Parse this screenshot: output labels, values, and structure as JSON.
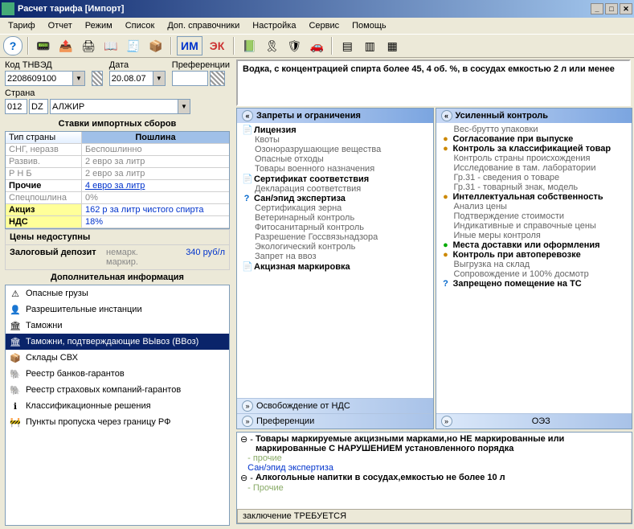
{
  "window": {
    "title": "Расчет тарифа [Импорт]"
  },
  "menu": [
    "Тариф",
    "Отчет",
    "Режим",
    "Список",
    "Доп. справочники",
    "Настройка",
    "Сервис",
    "Помощь"
  ],
  "fields": {
    "tnved_label": "Код ТНВЭД",
    "tnved": "2208609100",
    "date_label": "Дата",
    "date": "20.08.07",
    "pref_label": "Преференции",
    "pref": "",
    "country_label": "Страна",
    "country_code": "012",
    "country_iso": "DZ",
    "country_name": "АЛЖИР"
  },
  "description": "Водка, с концентрацией спирта более 45, 4 об. %, в сосудах емкостью 2 л или менее",
  "rates": {
    "header": "Ставки импортных сборов",
    "cols": [
      "Тип страны",
      "Пошлина"
    ],
    "rows": [
      {
        "c1": "СНГ, неразв",
        "c2": "Беспошлинно",
        "cls": "gray"
      },
      {
        "c1": "Развив.",
        "c2": "2 евро за литр",
        "cls": "gray"
      },
      {
        "c1": "Р Н Б",
        "c2": "2 евро за литр",
        "cls": "gray"
      },
      {
        "c1": "Прочие",
        "c2": "4 евро за литр",
        "cls": "blue-u",
        "bold": true
      }
    ],
    "extra": [
      {
        "c1": "Спецпошлина",
        "c2": "0%",
        "cls": "gray"
      },
      {
        "c1": "Акциз",
        "c2": "162 р за литр чистого спирта",
        "cls": "blue",
        "yl": true
      },
      {
        "c1": "НДС",
        "c2": "18%",
        "cls": "blue",
        "yl": true
      }
    ]
  },
  "prices": {
    "unavail": "Цены недоступны",
    "deposit_label": "Залоговый депозит",
    "deposit_note": "немарк. маркир.",
    "deposit_value": "340 руб/л"
  },
  "addinfo": {
    "header": "Дополнительная информация",
    "items": [
      {
        "ic": "⚠",
        "label": "Опасные грузы"
      },
      {
        "ic": "👤",
        "label": "Разрешительные инстанции"
      },
      {
        "ic": "🏛",
        "label": "Таможни"
      },
      {
        "ic": "🏛",
        "label": "Таможни, подтверждающие ВЫвоз (ВВоз)",
        "sel": true
      },
      {
        "ic": "📦",
        "label": "Склады СВХ"
      },
      {
        "ic": "🐘",
        "label": "Реестр банков-гарантов"
      },
      {
        "ic": "🐘",
        "label": "Реестр страховых компаний-гарантов"
      },
      {
        "ic": "ℹ",
        "label": "Классификационные решения"
      },
      {
        "ic": "🚧",
        "label": "Пункты пропуска через границу РФ"
      }
    ]
  },
  "restrict": {
    "title": "Запреты и ограничения",
    "items": [
      {
        "t": "Лицензия",
        "b": true,
        "ic": "📄"
      },
      {
        "t": "Квоты",
        "sub": true
      },
      {
        "t": "Озоноразрушающие вещества",
        "sub": true
      },
      {
        "t": "Опасные отходы",
        "sub": true
      },
      {
        "t": "Товары военного назначения",
        "sub": true
      },
      {
        "t": "Сертификат соответствия",
        "b": true,
        "ic": "📄"
      },
      {
        "t": "Декларация соответствия",
        "sub": true
      },
      {
        "t": "Сан/эпид экспертиза",
        "b": true,
        "ic": "?"
      },
      {
        "t": "Сертификация зерна",
        "sub": true
      },
      {
        "t": "Ветеринарный контроль",
        "sub": true
      },
      {
        "t": "Фитосанитарный контроль",
        "sub": true
      },
      {
        "t": "Разрешение Госсвязьнадзора",
        "sub": true
      },
      {
        "t": "Экологический контроль",
        "sub": true
      },
      {
        "t": "Запрет на ввоз",
        "sub": true
      },
      {
        "t": "Акцизная маркировка",
        "b": true,
        "ic": "📄"
      }
    ],
    "sub1": "Освобождение от НДС",
    "sub2": "Преференции"
  },
  "enhanced": {
    "title": "Усиленный контроль",
    "items": [
      {
        "t": "Вес-брутто упаковки",
        "sub": true
      },
      {
        "t": "Согласование при выпуске",
        "b": true,
        "ic": "●"
      },
      {
        "t": "Контроль за классификацией товар",
        "b": true,
        "ic": "●"
      },
      {
        "t": "Контроль страны происхождения",
        "sub": true
      },
      {
        "t": "Исследование в там. лаборатории",
        "sub": true
      },
      {
        "t": "Гр.31 - сведения о товаре",
        "sub": true
      },
      {
        "t": "Гр.31 - товарный знак, модель",
        "sub": true
      },
      {
        "t": "Интеллектуальная собственность",
        "b": true,
        "ic": "●"
      },
      {
        "t": "Анализ цены",
        "sub": true
      },
      {
        "t": "Подтверждение стоимости",
        "sub": true
      },
      {
        "t": "Индикативные и справочные цены",
        "sub": true
      },
      {
        "t": "Иные меры контроля",
        "sub": true
      },
      {
        "t": "Места доставки или оформления",
        "b": true,
        "ic": "●",
        "green": true
      },
      {
        "t": "Контроль при автоперевозке",
        "b": true,
        "ic": "●"
      },
      {
        "t": "Выгрузка на склад",
        "sub": true
      },
      {
        "t": "Сопровождение и 100% досмотр",
        "sub": true
      },
      {
        "t": "Запрещено помещение на ТС",
        "b": true,
        "ic": "?"
      }
    ],
    "sub": "ОЭЗ"
  },
  "bottom": {
    "items": [
      {
        "pre": "⊖ -",
        "t": "Товары маркируемые акцизными марками,но НЕ маркированные или маркированные С НАРУШЕНИЕМ установленного порядка",
        "b": true
      },
      {
        "pre": "  ",
        "t": "- прочие",
        "cls": "goldish"
      },
      {
        "pre": "  ",
        "t": "Сан/эпид экспертиза",
        "cls": "blue"
      },
      {
        "pre": "⊖ -",
        "t": "Алкогольные напитки в сосудах,емкостью не более 10 л",
        "b": true
      },
      {
        "pre": "  ",
        "t": "- Прочие",
        "cls": "goldish"
      }
    ],
    "status": "заключение ТРЕБУЕТСЯ"
  }
}
